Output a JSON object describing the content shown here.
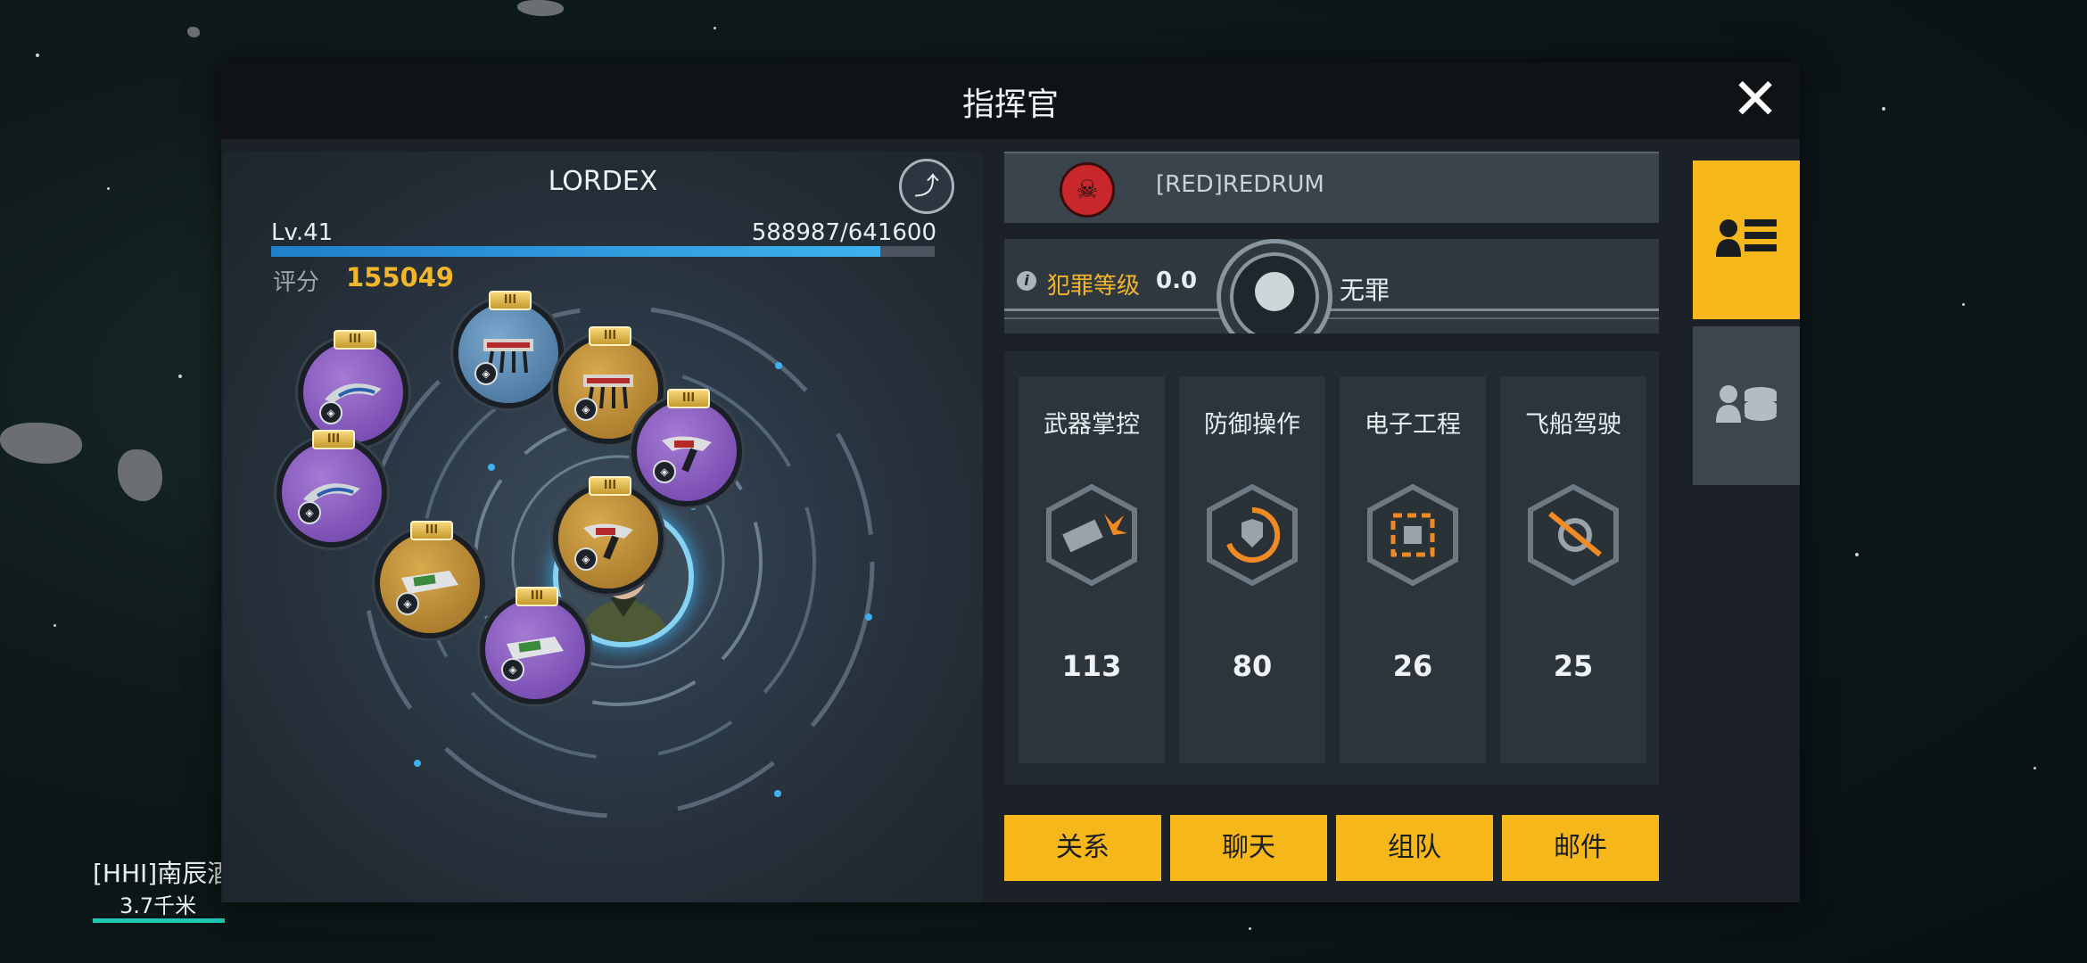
{
  "world": {
    "target_label": "[HHI]南辰酒",
    "target_distance": "3.7千米"
  },
  "panel": {
    "title": "指挥官",
    "close_symbol": "✕"
  },
  "profile": {
    "name": "LORDEX",
    "level": "Lv.41",
    "xp_text": "588987/641600",
    "xp_fraction": 0.918,
    "score_label": "评分",
    "score_value": "155049",
    "avatar_icon": "commander-portrait"
  },
  "modules": [
    {
      "tier": "III",
      "color": "purple",
      "icon": "wing-module-icon"
    },
    {
      "tier": "III",
      "color": "blue",
      "icon": "rack-module-icon"
    },
    {
      "tier": "III",
      "color": "gold",
      "icon": "rack-module-icon"
    },
    {
      "tier": "III",
      "color": "purple",
      "icon": "thruster-module-icon"
    },
    {
      "tier": "III",
      "color": "purple",
      "icon": "wing-module-icon"
    },
    {
      "tier": "III",
      "color": "gold",
      "icon": "thruster-module-icon"
    },
    {
      "tier": "III",
      "color": "gold",
      "icon": "cannon-module-icon"
    },
    {
      "tier": "III",
      "color": "purple",
      "icon": "cannon-module-icon"
    }
  ],
  "guild": {
    "name": "[RED]REDRUM",
    "emblem_icon": "skull-emblem-icon",
    "emblem_color": "#c8272b"
  },
  "crime": {
    "label": "犯罪等级",
    "value": "0.0",
    "state": "无罪"
  },
  "skills": [
    {
      "name": "武器掌控",
      "value": "113",
      "icon": "weapon-icon"
    },
    {
      "name": "防御操作",
      "value": "80",
      "icon": "shield-icon"
    },
    {
      "name": "电子工程",
      "value": "26",
      "icon": "chip-icon"
    },
    {
      "name": "飞船驾驶",
      "value": "25",
      "icon": "steering-icon"
    }
  ],
  "buttons": {
    "relation": "关系",
    "chat": "聊天",
    "team": "组队",
    "mail": "邮件"
  },
  "tabs": [
    {
      "icon": "profile-list-icon",
      "active": true
    },
    {
      "icon": "profile-stack-icon",
      "active": false
    }
  ],
  "colors": {
    "accent": "#f5b71a",
    "score": "#f1b62a",
    "xp_bar": "#3eb2ee"
  }
}
